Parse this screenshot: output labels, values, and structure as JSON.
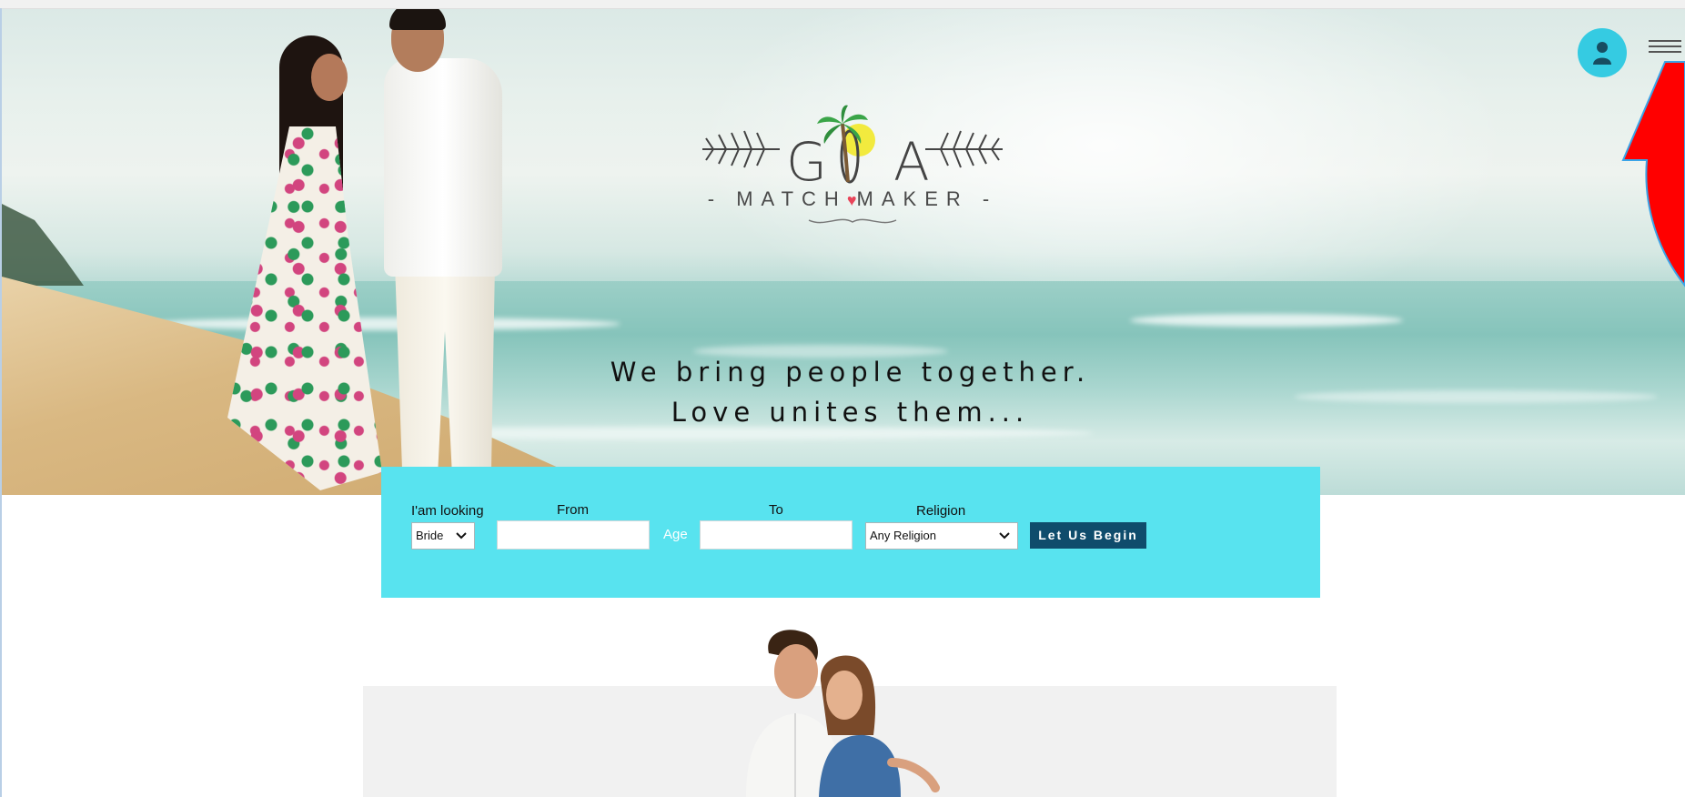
{
  "hero": {
    "logo": {
      "letters": [
        "G",
        "A"
      ],
      "wordmark_left": "- MATCH",
      "wordmark_right": "MAKER -"
    },
    "tagline_line1": "We bring people together.",
    "tagline_line2": "Love unites them..."
  },
  "header": {
    "user_icon": "user-icon",
    "menu_icon": "hamburger-menu-icon"
  },
  "search": {
    "looking_label": "I'am looking",
    "looking_value": "Bride",
    "from_label": "From",
    "from_value": "",
    "age_label": "Age",
    "to_label": "To",
    "to_value": "",
    "religion_label": "Religion",
    "religion_value": "Any Religion",
    "submit_label": "Let Us Begin"
  },
  "colors": {
    "panel": "#58e3ef",
    "accent": "#35cbe2",
    "button": "#0f4c6c",
    "annotation_arrow": "#ff0000"
  }
}
